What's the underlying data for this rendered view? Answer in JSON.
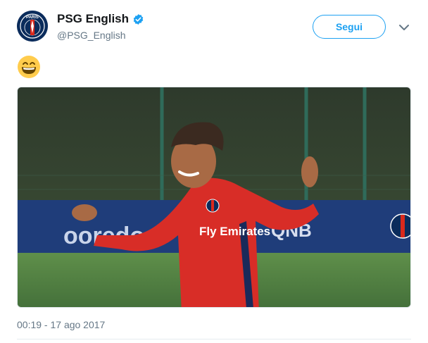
{
  "tweet": {
    "display_name": "PSG English",
    "handle": "@PSG_English",
    "verified": true,
    "follow_label": "Segui",
    "emoji": "grinning-face-with-smiling-eyes",
    "timestamp": "00:19 - 17 ago 2017"
  },
  "media": {
    "sponsor_left": "ooredoo",
    "sponsor_right": "QNB",
    "shirt_text": "Fly Emirates"
  },
  "avatar": {
    "text": "PARIS"
  },
  "colors": {
    "accent": "#1da1f2",
    "handle_gray": "#657786",
    "psg_navy": "#0b2c5c",
    "psg_red": "#da291c"
  }
}
